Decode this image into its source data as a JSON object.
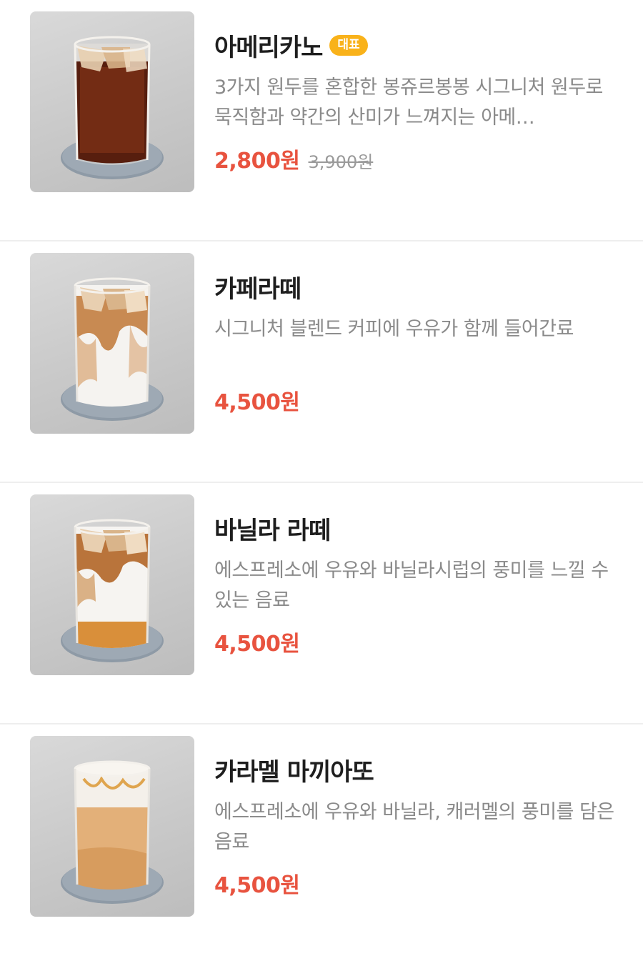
{
  "menu": {
    "items": [
      {
        "name": "아메리카노",
        "badge": "대표",
        "description": "3가지 원두를 혼합한 봉쥬르봉봉 시그니처 원두로 묵직함과 약간의 산미가 느껴지는 아메…",
        "price": "2,800원",
        "original_price": "3,900원",
        "image": "iced-americano-photo"
      },
      {
        "name": "카페라떼",
        "description": "시그니처 블렌드 커피에 우유가 함께 들어간료",
        "price": "4,500원",
        "image": "iced-cafe-latte-photo"
      },
      {
        "name": "바닐라 라떼",
        "description": "에스프레소에 우유와 바닐라시럽의 풍미를 느낄 수 있는 음료",
        "price": "4,500원",
        "image": "iced-vanilla-latte-photo"
      },
      {
        "name": "카라멜 마끼아또",
        "description": "에스프레소에 우유와 바닐라, 캐러멜의 풍미를 담은 음료",
        "price": "4,500원",
        "image": "iced-caramel-macchiato-photo"
      }
    ]
  },
  "colors": {
    "price": "#e8533f",
    "badge": "#f9b21a",
    "description": "#8a8a8a",
    "divider": "#eeeeee"
  }
}
